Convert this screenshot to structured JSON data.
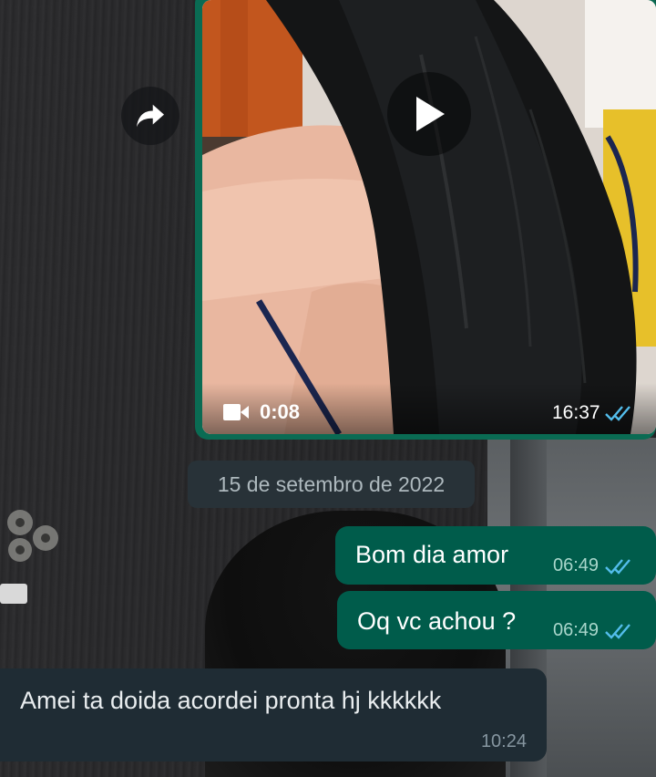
{
  "video_message": {
    "duration": "0:08",
    "time": "16:37",
    "status_icon": "double-check-icon",
    "play_icon": "play-icon",
    "camera_icon": "video-camera-icon"
  },
  "forward_icon": "forward-arrow-icon",
  "date_divider": "15 de setembro de 2022",
  "messages": [
    {
      "direction": "outgoing",
      "text": "Bom dia amor",
      "time": "06:49",
      "status": "read"
    },
    {
      "direction": "outgoing",
      "text": "Oq vc achou ?",
      "time": "06:49",
      "status": "read"
    },
    {
      "direction": "incoming",
      "text": "Amei ta doida acordei pronta hj kkkkkk",
      "time": "10:24"
    }
  ],
  "colors": {
    "outgoing_bubble": "#005c4b",
    "incoming_bubble": "#1f2c34",
    "read_tick": "#53bdeb",
    "date_pill": "#283238"
  }
}
